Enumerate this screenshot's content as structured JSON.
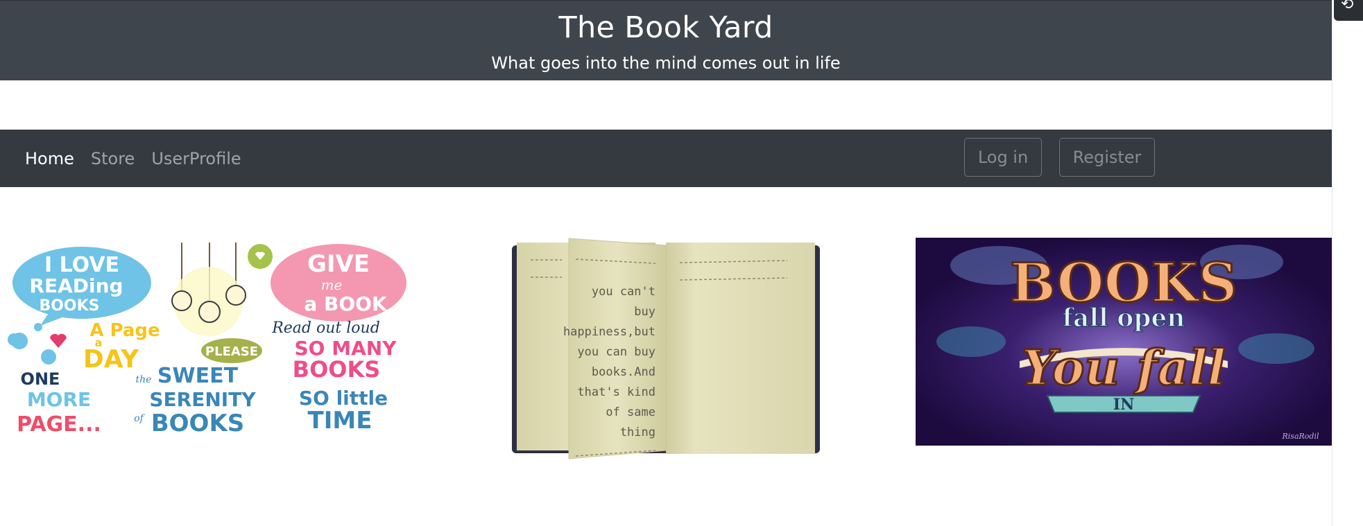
{
  "header": {
    "title": "The Book Yard",
    "subtitle": "What goes into the mind comes out in life"
  },
  "nav": {
    "links": [
      {
        "label": "Home",
        "active": true
      },
      {
        "label": "Store",
        "active": false
      },
      {
        "label": "UserProfile",
        "active": false
      }
    ],
    "login_label": "Log in",
    "register_label": "Register"
  },
  "images": {
    "left": {
      "phrases": {
        "i_love": "I LOVE",
        "reading": "READing",
        "books": "BOOKS",
        "give": "GIVE",
        "me": "me",
        "a_book": "a BOOK",
        "read_out_loud": "Read out loud",
        "a_page": "A Page",
        "a": "a",
        "day": "DAY",
        "please": "PLEASE",
        "so_many": "SO MANY",
        "books2": "BOOKS",
        "one": "ONE",
        "more": "MORE",
        "page": "PAGE...",
        "the": "the",
        "sweet": "SWEET",
        "serenity": "SERENITY",
        "of": "of",
        "books3": "BOOKS",
        "so_little": "SO little",
        "time": "TIME"
      }
    },
    "middle": {
      "quote_lines": [
        "you can't",
        "buy",
        "happiness,but",
        "you can buy",
        "books.And",
        "that's kind",
        "of same",
        "thing"
      ]
    },
    "right": {
      "line1": "BOOKS",
      "line2": "fall open",
      "line3": "You fall",
      "line4": "IN",
      "credit": "RisaRodil"
    }
  },
  "colors": {
    "header_bg": "#3f454c",
    "navbar_bg": "#353a40",
    "active_link": "#ffffff",
    "inactive_link": "#9ea4aa"
  }
}
